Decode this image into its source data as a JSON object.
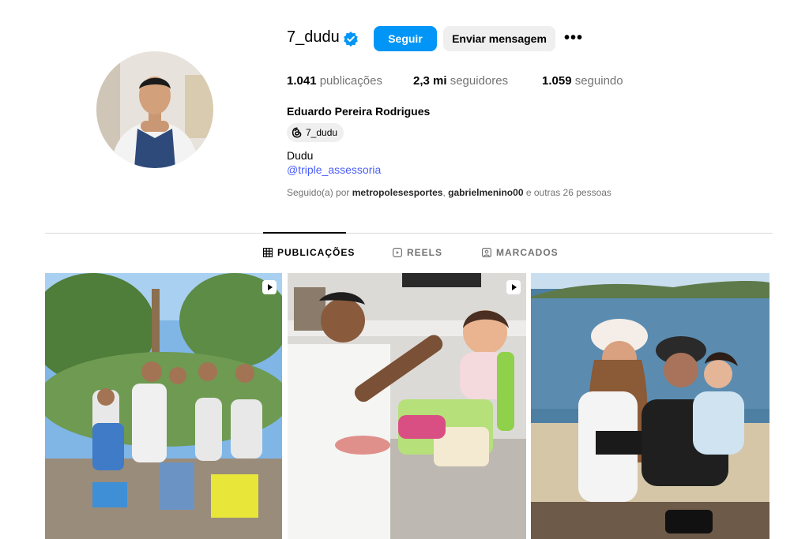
{
  "profile": {
    "username": "7_dudu",
    "follow_label": "Seguir",
    "message_label": "Enviar mensagem",
    "more_label": "•••",
    "full_name": "Eduardo Pereira Rodrigues",
    "threads_handle": "7_dudu",
    "bio": "Dudu",
    "link": "@triple_assessoria"
  },
  "stats": {
    "posts_value": "1.041",
    "posts_label": "publicações",
    "followers_value": "2,3 mi",
    "followers_label": "seguidores",
    "following_value": "1.059",
    "following_label": "seguindo"
  },
  "followed_by": {
    "prefix": "Seguido(a) por",
    "user1": "metropolesesportes",
    "sep": ",",
    "user2": "gabrielmenino00",
    "suffix": "e outras 26 pessoas"
  },
  "tabs": [
    {
      "label": "PUBLICAÇÕES",
      "icon": "grid-icon",
      "active": true
    },
    {
      "label": "REELS",
      "icon": "reels-icon",
      "active": false
    },
    {
      "label": "MARCADOS",
      "icon": "tagged-icon",
      "active": false
    }
  ],
  "posts": [
    {
      "scene": "family-group-outdoors",
      "type": "reel"
    },
    {
      "scene": "feeding-baby-kitchen",
      "type": "reel"
    },
    {
      "scene": "couple-baby-boat",
      "type": "photo"
    }
  ],
  "colors": {
    "accent": "#0095f6",
    "link": "#4a5df9",
    "muted": "#737373"
  }
}
